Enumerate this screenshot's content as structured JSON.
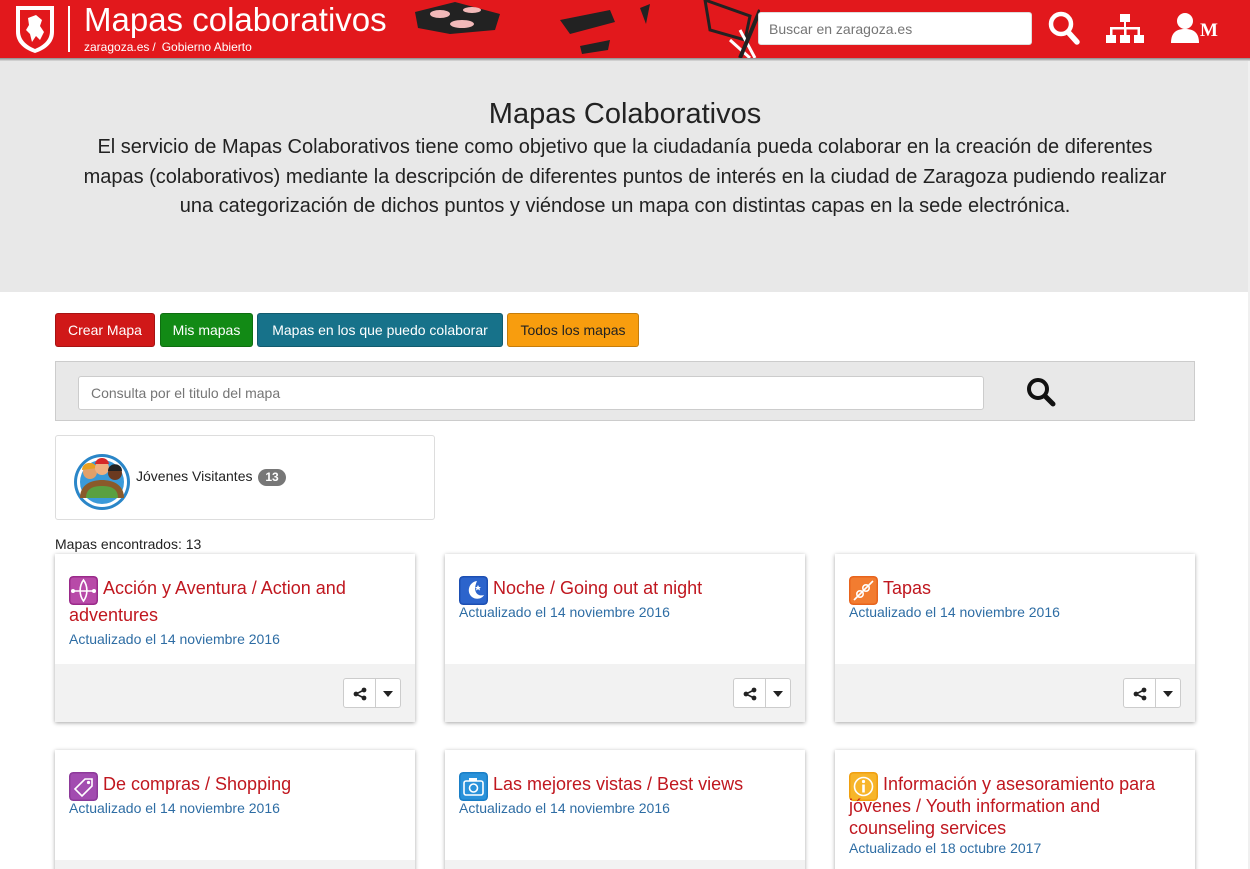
{
  "header": {
    "site_title": "Mapas colaborativos",
    "breadcrumb": [
      "zaragoza.es",
      "Gobierno Abierto"
    ],
    "breadcrumb_separator": "/",
    "search_placeholder": "Buscar en zaragoza.es",
    "user_initial": "M",
    "icons": [
      "search-icon",
      "sitemap-icon",
      "user-icon"
    ]
  },
  "banner": {
    "title": "Mapas Colaborativos",
    "description": "El servicio de Mapas Colaborativos tiene como objetivo que la ciudadanía pueda colaborar en la creación de diferentes mapas (colaborativos) mediante la descripción de diferentes puntos de interés en la ciudad de Zaragoza pudiendo realizar una categorización de dichos puntos y viéndose un mapa con distintas capas en la sede electrónica."
  },
  "buttons": [
    {
      "label": "Crear Mapa",
      "color": "#d01818"
    },
    {
      "label": "Mis mapas",
      "color": "#128a15"
    },
    {
      "label": "Mapas en los que puedo colaborar",
      "color": "#17728a"
    },
    {
      "label": "Todos los mapas",
      "color": "#f89d0e"
    }
  ],
  "query": {
    "placeholder": "Consulta por el titulo del mapa"
  },
  "category": {
    "label": "Jóvenes Visitantes",
    "count": "13"
  },
  "results": {
    "text": "Mapas encontrados: 13"
  },
  "cards": [
    {
      "title": "Acción y Aventura / Action and adventures",
      "date": "Actualizado el 14 noviembre 2016",
      "icon": "kayak-icon",
      "icon_color": "#9a2a8a"
    },
    {
      "title": "Noche / Going out at night",
      "date": "Actualizado el 14 noviembre 2016",
      "icon": "moon-icon",
      "icon_color": "#1d4fb3"
    },
    {
      "title": "Tapas",
      "date": "Actualizado el 14 noviembre 2016",
      "icon": "skewer-icon",
      "icon_color": "#e8641d"
    },
    {
      "title": "De compras / Shopping",
      "date": "Actualizado el 14 noviembre 2016",
      "icon": "tag-icon",
      "icon_color": "#8d3a9a"
    },
    {
      "title": "Las mejores vistas / Best views",
      "date": "Actualizado el 14 noviembre 2016",
      "icon": "camera-icon",
      "icon_color": "#1a7fc7"
    },
    {
      "title": "Información y asesoramiento para jóvenes / Youth information and counseling services",
      "date": "Actualizado el 18 octubre 2017",
      "icon": "info-icon",
      "icon_color": "#f0a010"
    }
  ]
}
